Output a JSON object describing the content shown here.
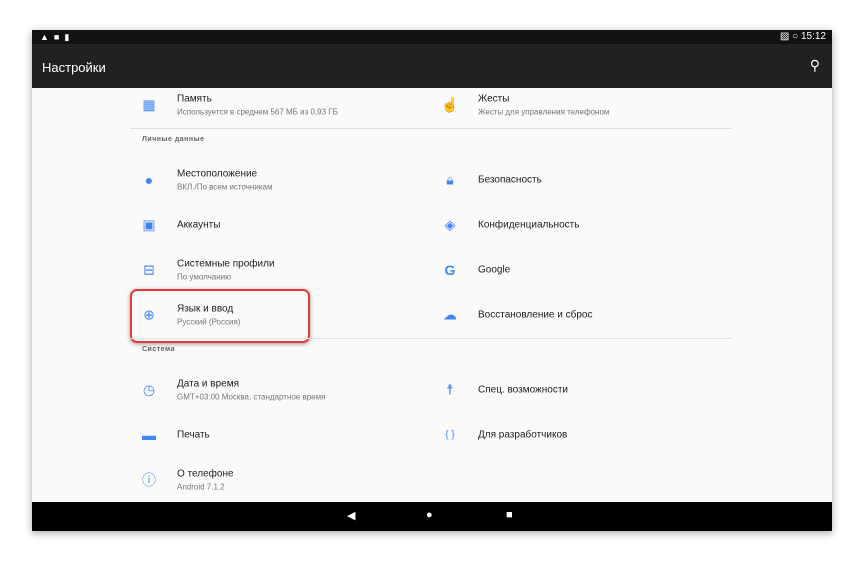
{
  "status": {
    "time": "15:12"
  },
  "toolbar": {
    "title": "Настройки"
  },
  "top": [
    {
      "title": "Память",
      "subtitle": "Используется в среднем 567 МБ из 0,93 ГБ"
    },
    {
      "title": "Жесты",
      "subtitle": "Жесты для управления телефоном"
    }
  ],
  "sections": [
    {
      "header": "Личные данные",
      "left": [
        {
          "title": "Местоположение",
          "subtitle": "ВКЛ./По всем источникам"
        },
        {
          "title": "Аккаунты"
        },
        {
          "title": "Системные профили",
          "subtitle": "По умолчанию"
        },
        {
          "title": "Язык и ввод",
          "subtitle": "Русский (Россия)"
        }
      ],
      "right": [
        {
          "title": "Безопасность"
        },
        {
          "title": "Конфиденциальность"
        },
        {
          "title": "Google"
        },
        {
          "title": "Восстановление и сброс"
        }
      ]
    },
    {
      "header": "Система",
      "left": [
        {
          "title": "Дата и время",
          "subtitle": "GMT+03:00 Москва, стандартное время"
        },
        {
          "title": "Печать"
        },
        {
          "title": "О телефоне",
          "subtitle": "Android 7.1.2"
        }
      ],
      "right": [
        {
          "title": "Спец. возможности"
        },
        {
          "title": "Для разработчиков"
        }
      ]
    }
  ],
  "highlight_color": "#e53935"
}
